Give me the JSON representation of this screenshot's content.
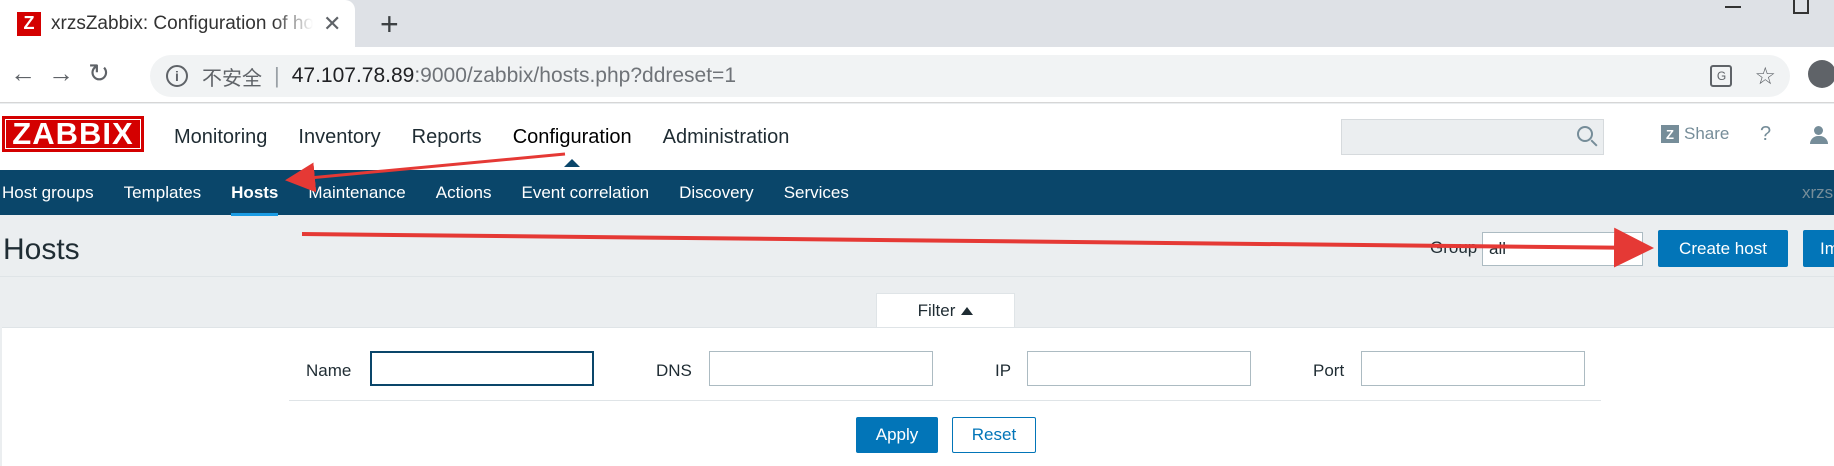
{
  "browser": {
    "tab_title": "xrzsZabbix: Configuration of hosts",
    "favicon_letter": "Z",
    "close_glyph": "✕",
    "new_tab_glyph": "+",
    "insecure_label": "不安全",
    "url_host": "47.107.78.89",
    "url_rest": ":9000/zabbix/hosts.php?ddreset=1"
  },
  "header": {
    "logo": "ZABBIX",
    "menu": [
      "Monitoring",
      "Inventory",
      "Reports",
      "Configuration",
      "Administration"
    ],
    "active_menu": "Configuration",
    "share_label": "Share",
    "help_glyph": "?"
  },
  "sub_menu": {
    "items": [
      "Host groups",
      "Templates",
      "Hosts",
      "Maintenance",
      "Actions",
      "Event correlation",
      "Discovery",
      "Services"
    ],
    "active": "Hosts",
    "right_text": "xrzs"
  },
  "page": {
    "title": "Hosts",
    "group_label": "Group",
    "group_value": "all",
    "create_host_label": "Create host",
    "import_label": "Import"
  },
  "filter": {
    "tab_label": "Filter",
    "name_label": "Name",
    "dns_label": "DNS",
    "ip_label": "IP",
    "port_label": "Port",
    "name_value": "",
    "dns_value": "",
    "ip_value": "",
    "port_value": "",
    "apply_label": "Apply",
    "reset_label": "Reset"
  },
  "colors": {
    "brand_red": "#d40000",
    "submenu_bg": "#0a466a",
    "primary": "#0275b8",
    "annotation_arrow": "#e53935"
  }
}
